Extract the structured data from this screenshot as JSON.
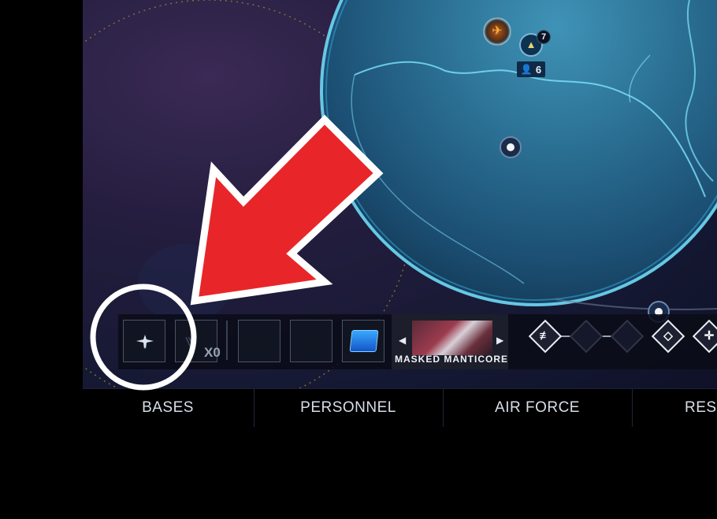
{
  "map": {
    "base_badge_count": "7",
    "personnel_count": "6",
    "squad_icon": "aircraft-icon",
    "base_icon": "base-icon",
    "personnel_icon": "person-icon"
  },
  "hud": {
    "rank_label": "X0",
    "unit_name": "MASKED MANTICORE",
    "prev_icon": "◀",
    "next_icon": "▶",
    "module_color": "#2b8fff"
  },
  "bottom_nav": {
    "tabs": [
      {
        "label": "BASES"
      },
      {
        "label": "PERSONNEL"
      },
      {
        "label": "AIR FORCE"
      },
      {
        "label": "RES"
      }
    ]
  },
  "annotation": {
    "arrow_color": "#e8262a",
    "circle_color": "#ffffff"
  }
}
